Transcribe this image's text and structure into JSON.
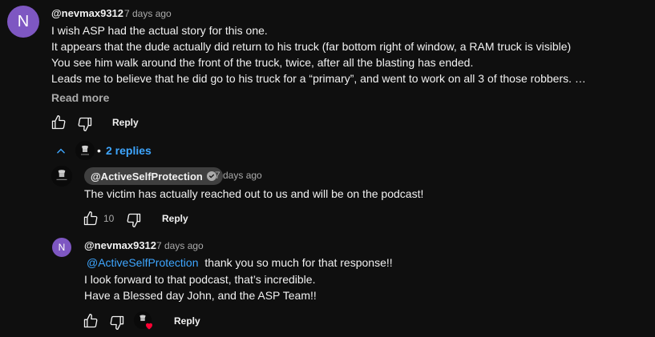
{
  "comment1": {
    "avatar_letter": "N",
    "avatar_color": "#7e57c2",
    "handle": "@nevmax9312",
    "time": "7 days ago",
    "lines": [
      "I wish ASP had the actual story for this one.",
      "It appears that the dude actually did return to his truck (far bottom right of window, a RAM truck is visible)",
      "You see him walk around the front of the truck, twice, after all the blasting has ended.",
      "Leads me to believe that he did go to his truck for a “primary”, and went to work on all 3 of those robbers. …"
    ],
    "read_more": "Read more",
    "reply_label": "Reply",
    "icons": [
      "thumbs-up-icon",
      "thumbs-down-icon"
    ]
  },
  "replies_toggle": {
    "label": "2 replies",
    "bullet": "•",
    "icon": "chevron-up-icon",
    "color": "#3ea6ff"
  },
  "reply1": {
    "handle": "@ActiveSelfProtection",
    "verified_icon": "checkmark-icon",
    "time": "7 days ago",
    "text": "The victim has actually reached out to us and will be on the podcast!",
    "like_count": "10",
    "reply_label": "Reply"
  },
  "reply2": {
    "avatar_letter": "N",
    "handle": "@nevmax9312",
    "time": "7 days ago",
    "mention": "@ActiveSelfProtection",
    "line1_rest": "thank you so much for that response!!",
    "line2": "I look forward to that podcast, that’s incredible.",
    "line3": "Have a Blessed day John, and the ASP Team!!",
    "reply_label": "Reply",
    "creator_heart_icon": "heart-icon"
  }
}
